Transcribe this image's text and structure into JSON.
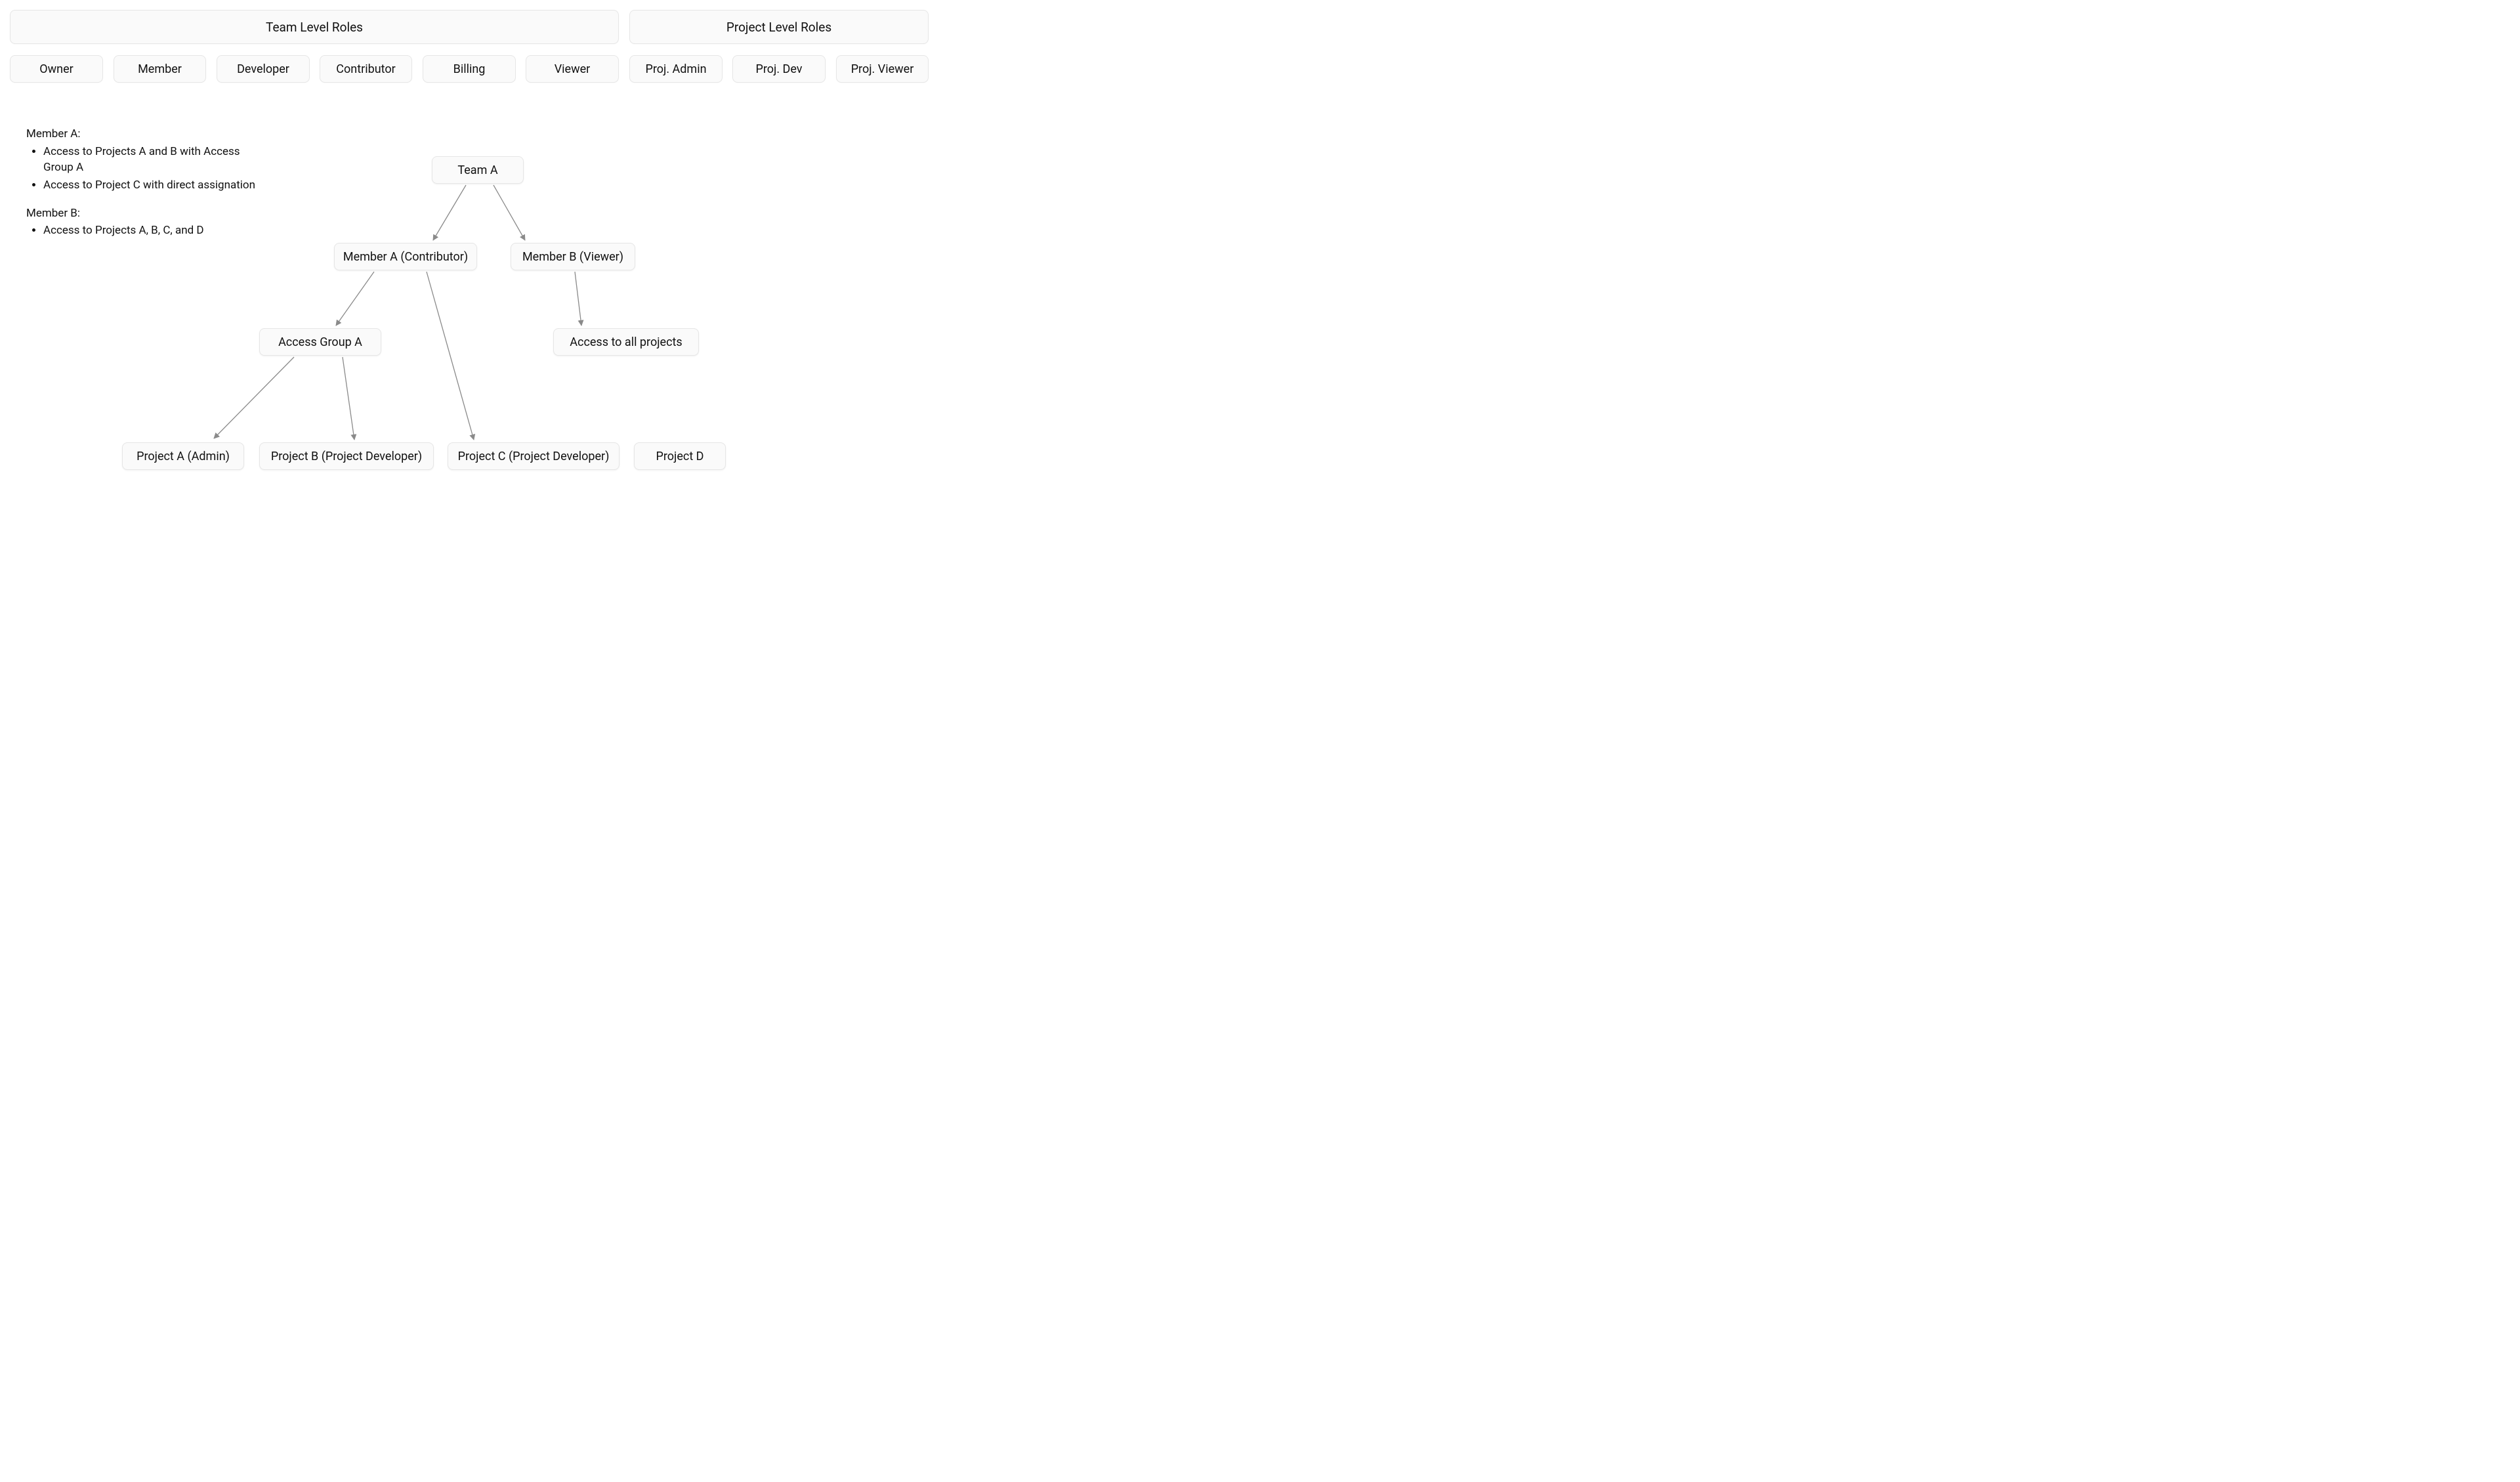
{
  "headers": {
    "team": "Team Level Roles",
    "project": "Project Level Roles"
  },
  "team_roles": [
    "Owner",
    "Member",
    "Developer",
    "Contributor",
    "Billing",
    "Viewer"
  ],
  "project_roles": [
    "Proj. Admin",
    "Proj. Dev",
    "Proj. Viewer"
  ],
  "notes": {
    "memberA": {
      "title": "Member A:",
      "bullets": [
        "Access to Projects A and B with Access Group A",
        "Access to Project C with direct assignation"
      ]
    },
    "memberB": {
      "title": "Member B:",
      "bullets": [
        "Access to Projects A, B, C, and D"
      ]
    }
  },
  "nodes": {
    "team": "Team A",
    "memberA": "Member A (Contributor)",
    "memberB": "Member B (Viewer)",
    "accessGroupA": "Access Group A",
    "accessAll": "Access to all projects",
    "projectA": "Project A (Admin)",
    "projectB": "Project B (Project Developer)",
    "projectC": "Project C (Project Developer)",
    "projectD": "Project D"
  }
}
